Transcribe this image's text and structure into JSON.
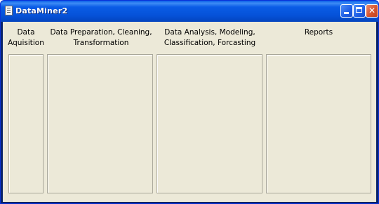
{
  "window": {
    "title": "DataMiner2",
    "buttons": {
      "minimize_icon": "minimize-icon",
      "maximize_icon": "maximize-icon",
      "close_icon": "close-icon"
    },
    "colors": {
      "titlebar": "#0552d8",
      "client_background": "#ece9d8",
      "panel_border": "#a9a79a",
      "close_button": "#d6542e"
    }
  },
  "columns": [
    {
      "label": "Data\nAquisition"
    },
    {
      "label": "Data Preparation, Cleaning,\nTransformation"
    },
    {
      "label": "Data Analysis, Modeling,\nClassification, Forcasting"
    },
    {
      "label": "Reports"
    }
  ]
}
